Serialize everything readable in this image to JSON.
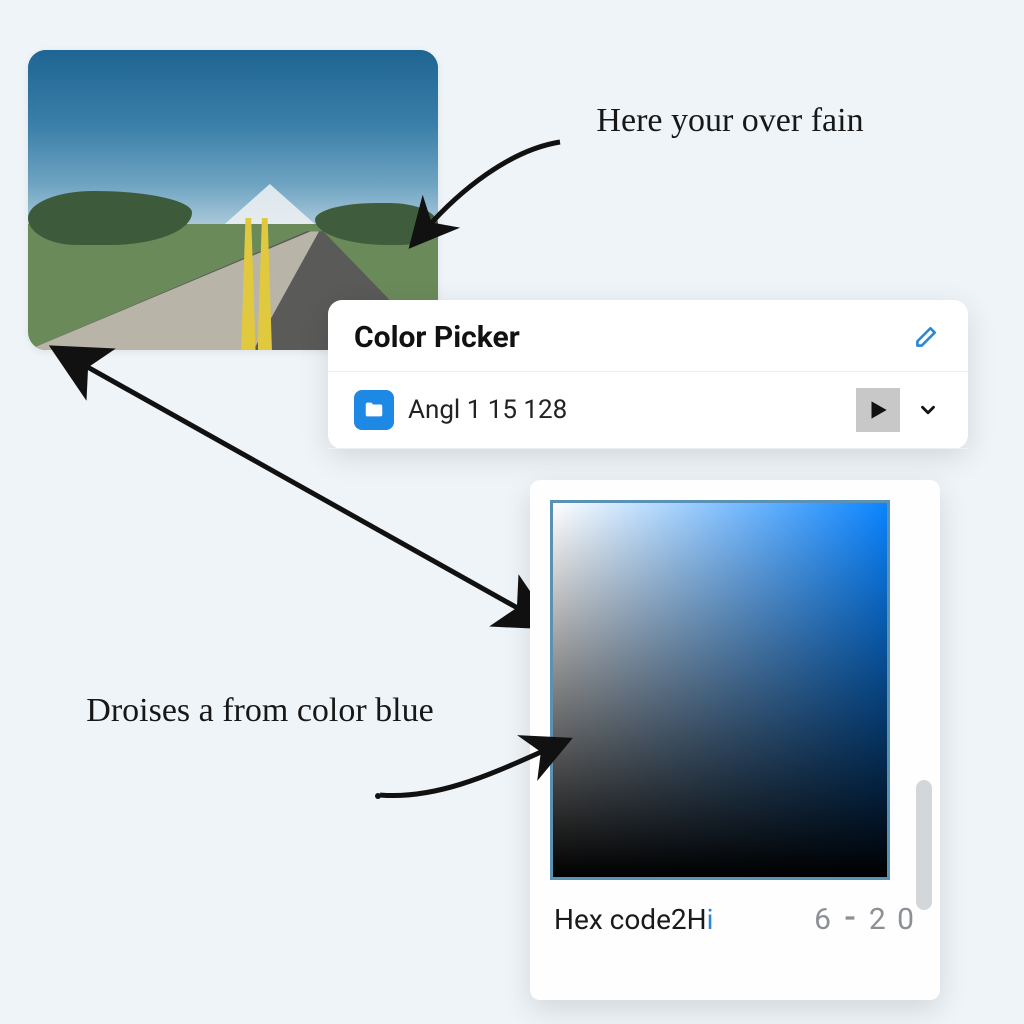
{
  "annotations": {
    "top": "Here your over fain",
    "left": "Droises a from color blue"
  },
  "panel": {
    "title": "Color Picker",
    "row_label": "Angl 1 15 128"
  },
  "swatch": {
    "hex_label_prefix": "Hex code2H",
    "hex_label_accent": "i",
    "hex_value": "6 ⁃ 2 0",
    "base_hue": "#0a84ff"
  },
  "icons": {
    "pencil": "pencil-icon",
    "folder": "folder-icon",
    "play": "play-icon",
    "chevron": "chevron-down-icon"
  }
}
